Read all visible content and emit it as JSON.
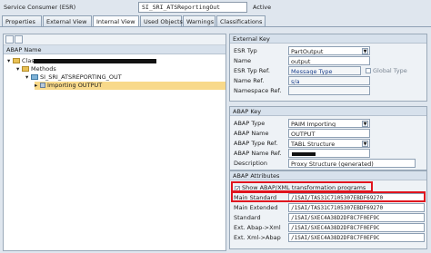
{
  "header": {
    "label": "Service Consumer (ESR)",
    "value": "SI_SRI_ATSReportingOut",
    "status": "Active"
  },
  "tabs": [
    "Properties",
    "External View",
    "Internal View",
    "Used Objects",
    "Warnings",
    "Classifications"
  ],
  "tree": {
    "column_header": "ABAP Name",
    "class_label": "Class",
    "methods_label": "Methods",
    "method_name": "SI_SRI_ATSREPORTING_OUT",
    "param_label": "Importing OUTPUT"
  },
  "external_key": {
    "title": "External Key",
    "esr_typ_label": "ESR Typ",
    "esr_typ_value": "PartOutput",
    "name_label": "Name",
    "name_value": "output",
    "esr_typ_ref_label": "ESR Typ Ref.",
    "esr_typ_ref_value": "Message Type",
    "global_type_label": "Global Type",
    "name_ref_label": "Name Ref.",
    "name_ref_value": "s/a",
    "namespace_ref_label": "Namespace Ref."
  },
  "abap_key": {
    "title": "ABAP Key",
    "abap_type_label": "ABAP Type",
    "abap_type_value": "PAIM Importing",
    "abap_name_label": "ABAP Name",
    "abap_name_value": "OUTPUT",
    "abap_type_ref_label": "ABAP Type Ref.",
    "abap_type_ref_value": "TABL Structure",
    "abap_name_ref_label": "ABAP Name Ref.",
    "description_label": "Description",
    "description_value": "Proxy Structure (generated)"
  },
  "abap_attributes": {
    "title": "ABAP Attributes",
    "show_label": "Show ABAP/XML transformation programs",
    "rows": [
      {
        "label": "Main Standard",
        "value": "/1SAI/TAS31C7105307EBDF69270"
      },
      {
        "label": "Main Extended",
        "value": "/1SAI/TAS31C7105307EBDF69270"
      },
      {
        "label": "Standard",
        "value": "/1SAI/SXEC4A38D2DF8C7F0EF9C"
      },
      {
        "label": "Ext. Abap->Xml",
        "value": "/1SAI/SXEC4A38D2DF8C7F0EF9C"
      },
      {
        "label": "Ext. Xml->Abap",
        "value": "/1SAI/SXEC4A38D2DF8C7F0EF9C"
      }
    ]
  },
  "colors": {
    "highlight": "#f8d98a",
    "redbox": "#e0141e"
  }
}
